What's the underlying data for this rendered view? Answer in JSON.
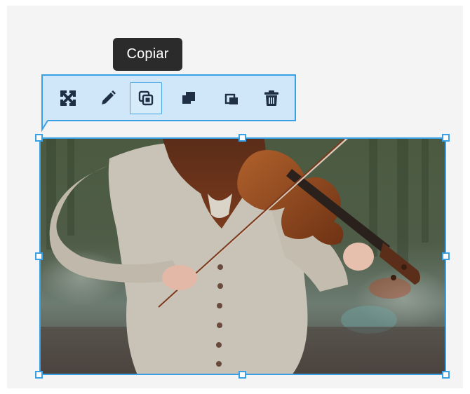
{
  "tooltip": {
    "text": "Copiar"
  },
  "toolbar": {
    "buttons": [
      {
        "name": "fullscreen-button",
        "icon": "expand-arrows-icon"
      },
      {
        "name": "edit-button",
        "icon": "pencil-icon"
      },
      {
        "name": "copy-button",
        "icon": "copy-icon",
        "active": true
      },
      {
        "name": "bring-forward-button",
        "icon": "bring-forward-icon"
      },
      {
        "name": "send-backward-button",
        "icon": "send-backward-icon"
      },
      {
        "name": "delete-button",
        "icon": "trash-icon"
      }
    ]
  },
  "image": {
    "subject": "violinist-photo"
  },
  "colors": {
    "accent": "#3aa0e6",
    "toolbar_bg": "#cfe7f9",
    "icon": "#1f2f45",
    "tooltip_bg": "#2b2b2b"
  }
}
